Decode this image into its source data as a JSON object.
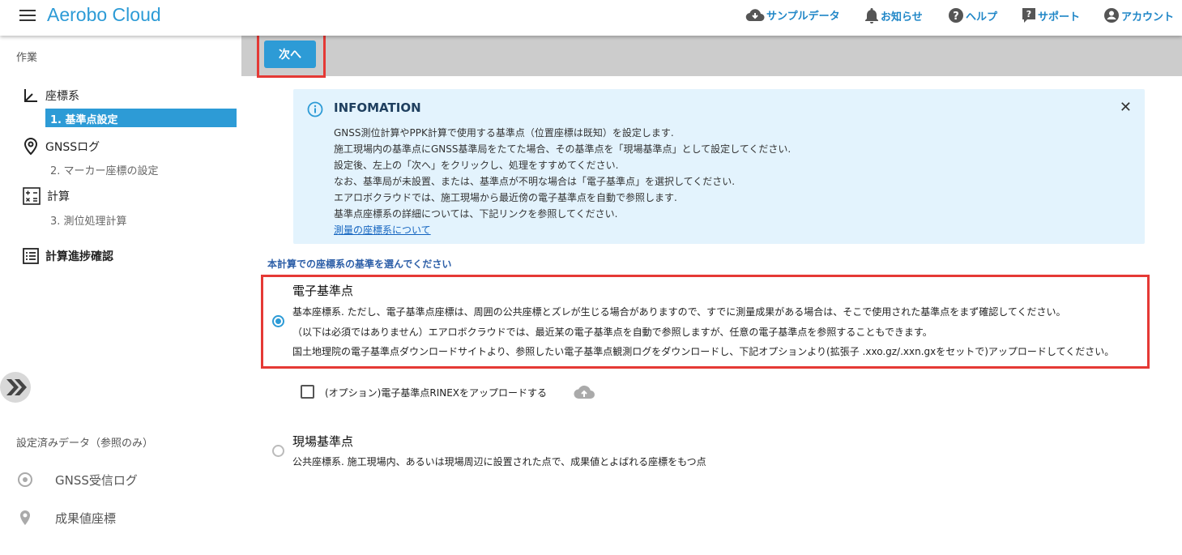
{
  "header": {
    "title": "Aerobo Cloud",
    "nav": {
      "sample": "サンプルデータ",
      "news": "お知らせ",
      "help": "ヘルプ",
      "support": "サポート",
      "account": "アカウント"
    }
  },
  "sidebar": {
    "section_work": "作業",
    "coord": "座標系",
    "coord_active": "1. 基準点設定",
    "gnss": "GNSSログ",
    "gnss_sub": "2. マーカー座標の設定",
    "calc": "計算",
    "calc_sub": "3. 測位処理計算",
    "progress": "計算進捗確認",
    "section_ref": "設定済みデータ（参照のみ）",
    "ref_gnss": "GNSS受信ログ",
    "ref_result": "成果値座標"
  },
  "toolbar": {
    "next_label": "次へ"
  },
  "info": {
    "title": "INFOMATION",
    "close": "✕",
    "lines": [
      "GNSS測位計算やPPK計算で使用する基準点（位置座標は既知）を設定します.",
      "施工現場内の基準点にGNSS基準局をたてた場合、その基準点を「現場基準点」として設定してください.",
      "設定後、左上の「次へ」をクリックし、処理をすすめてください.",
      "なお、基準局が未設置、または、基準点が不明な場合は「電子基準点」を選択してください.",
      "エアロボクラウドでは、施工現場から最近傍の電子基準点を自動で参照します.",
      "基準点座標系の詳細については、下記リンクを参照してください."
    ],
    "link": "測量の座標系について"
  },
  "main": {
    "section_label": "本計算での座標系の基準を選んでください",
    "option1": {
      "title": "電子基準点",
      "lines": [
        "基本座標系. ただし、電子基準点座標は、周囲の公共座標とズレが生じる場合がありますので、すでに測量成果がある場合は、そこで使用された基準点をまず確認してください。",
        "（以下は必須ではありません）エアロボクラウドでは、最近某の電子基準点を自動で参照しますが、任意の電子基準点を参照することもできます。",
        "国土地理院の電子基準点ダウンロードサイトより、参照したい電子基準点観測ログをダウンロードし、下記オプションより(拡張子 .xxo.gz/.xxn.gxをセットで)アップロードしてください。"
      ]
    },
    "upload_option": "(オプション)電子基準点RINEXをアップロードする",
    "option2": {
      "title": "現場基準点",
      "desc": "公共座標系. 施工現場内、あるいは現場周辺に設置された点で、成果値とよばれる座標をもつ点"
    }
  },
  "colors": {
    "accent": "#2d9bd6",
    "highlight": "#e53935",
    "info_bg": "#e3f3fd",
    "toolbar_bg": "#cccccc"
  }
}
